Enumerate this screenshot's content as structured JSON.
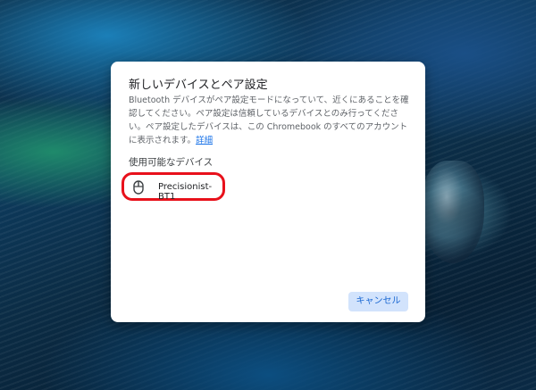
{
  "dialog": {
    "title": "新しいデバイスとペア設定",
    "description": "Bluetooth デバイスがペア設定モードになっていて、近くにあることを確認してください。ペア設定は信頼しているデバイスとのみ行ってください。ペア設定したデバイスは、この Chromebook のすべてのアカウントに表示されます。",
    "details_link": "詳細",
    "available_devices_label": "使用可能なデバイス",
    "devices": [
      {
        "name": "Precisionist-BT1",
        "icon": "mouse-icon"
      }
    ],
    "cancel_label": "キャンセル"
  },
  "colors": {
    "highlight": "#e8111b",
    "cancel_bg": "#d2e3fc",
    "cancel_text": "#1967d2",
    "link": "#1a73e8"
  }
}
